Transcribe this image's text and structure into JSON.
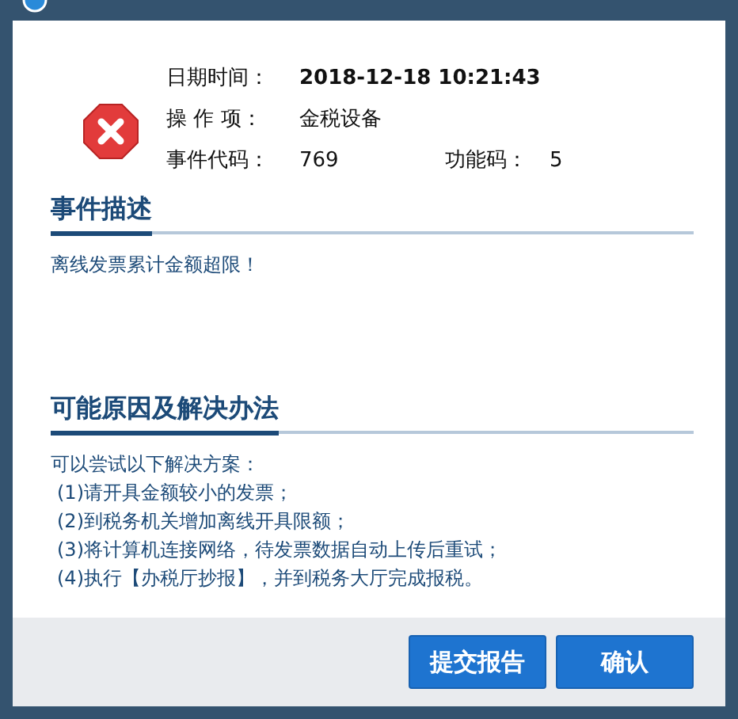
{
  "info": {
    "rows": [
      [
        {
          "label": "日期时间：",
          "value": "2018-12-18 10:21:43",
          "bold": true
        }
      ],
      [
        {
          "label": "操 作 项：",
          "value": "金税设备",
          "bold": false
        }
      ],
      [
        {
          "label": "事件代码：",
          "value": "769",
          "bold": false
        },
        {
          "label": "功能码：",
          "value": "5",
          "bold": false
        }
      ]
    ]
  },
  "sections": [
    {
      "title": "事件描述",
      "lines": [
        "离线发票累计金额超限！"
      ]
    },
    {
      "title": "可能原因及解决办法",
      "lines": [
        "可以尝试以下解决方案：",
        "(1)请开具金额较小的发票；",
        "(2)到税务机关增加离线开具限额；",
        "(3)将计算机连接网络，待发票数据自动上传后重试；",
        "(4)执行【办税厅抄报】，并到税务大厅完成报税。"
      ]
    }
  ],
  "buttons": [
    "提交报告",
    "确认"
  ]
}
